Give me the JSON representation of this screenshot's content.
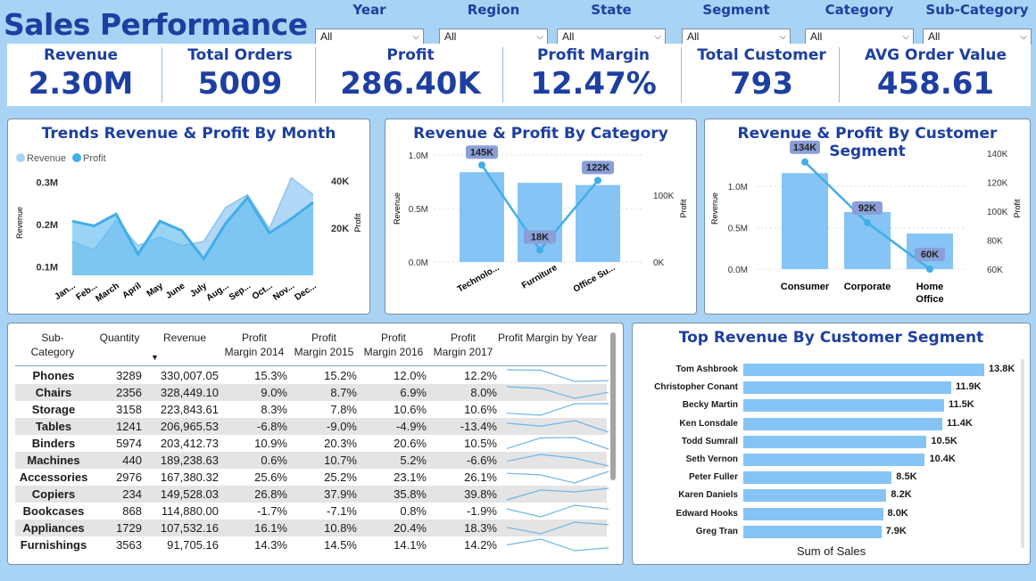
{
  "header": {
    "title": "Sales Performance"
  },
  "slicers": [
    {
      "label": "Year",
      "value": "All"
    },
    {
      "label": "Region",
      "value": "All"
    },
    {
      "label": "State",
      "value": "All"
    },
    {
      "label": "Segment",
      "value": "All"
    },
    {
      "label": "Category",
      "value": "All"
    },
    {
      "label": "Sub-Category",
      "value": "All"
    }
  ],
  "kpis": [
    {
      "label": "Revenue",
      "value": "2.30M"
    },
    {
      "label": "Total Orders",
      "value": "5009"
    },
    {
      "label": "Profit",
      "value": "286.40K"
    },
    {
      "label": "Profit Margin",
      "value": "12.47%"
    },
    {
      "label": "Total Customer",
      "value": "793"
    },
    {
      "label": "AVG Order Value",
      "value": "458.61"
    }
  ],
  "colors": {
    "accent": "#1d3fa1",
    "revenue": "#a9d3f5",
    "profit": "#41aee8",
    "bar": "#85c4f4",
    "badge": "#8a9fd8"
  },
  "monthly": {
    "title": "Trends Revenue & Profit By Month",
    "legend": {
      "revenue": "Revenue",
      "profit": "Profit"
    },
    "ylabel_left": "Revenue",
    "ylabel_right": "Profit",
    "yticks_left": [
      "0.3M",
      "0.2M",
      "0.1M"
    ],
    "yticks_right": [
      "40K",
      "20K"
    ],
    "months": [
      "Jan...",
      "Feb...",
      "March",
      "April",
      "May",
      "June",
      "July",
      "Aug...",
      "Sep...",
      "Oct...",
      "Nov...",
      "Dec..."
    ]
  },
  "category": {
    "title": "Revenue & Profit By Category",
    "ylabel_left": "Revenue",
    "ylabel_right": "Profit",
    "yticks_left": [
      "1.0M",
      "0.5M",
      "0.0M"
    ],
    "yticks_right": [
      "100K",
      "0K"
    ],
    "items": [
      "Technolo...",
      "Furniture",
      "Office Su..."
    ],
    "profit_labels": [
      "145K",
      "18K",
      "122K"
    ]
  },
  "segment": {
    "title": "Revenue & Profit By Customer Segment",
    "ylabel_left": "Revenue",
    "ylabel_right": "Profit",
    "yticks_left": [
      "1.0M",
      "0.5M",
      "0.0M"
    ],
    "yticks_right": [
      "140K",
      "120K",
      "100K",
      "80K",
      "60K"
    ],
    "items": [
      "Consumer",
      "Corporate",
      "Home",
      "Office"
    ],
    "profit_labels": [
      "134K",
      "92K",
      "60K"
    ]
  },
  "chart_data": [
    {
      "type": "area",
      "title": "Trends Revenue & Profit By Month",
      "categories": [
        "Jan...",
        "Feb...",
        "March",
        "April",
        "May",
        "June",
        "July",
        "Aug...",
        "Sep...",
        "Oct...",
        "Nov...",
        "Dec..."
      ],
      "series": [
        {
          "name": "Revenue",
          "axis": "left",
          "values": [
            0.16,
            0.14,
            0.21,
            0.15,
            0.17,
            0.15,
            0.16,
            0.24,
            0.27,
            0.19,
            0.31,
            0.27
          ]
        },
        {
          "name": "Profit",
          "axis": "right",
          "values": [
            23,
            21,
            26,
            9,
            23,
            19,
            7,
            22,
            33,
            18,
            24,
            31
          ]
        }
      ],
      "ylim_left": [
        0.08,
        0.33
      ],
      "ylim_right": [
        0,
        45
      ]
    },
    {
      "type": "bar",
      "title": "Revenue & Profit By Category",
      "categories": [
        "Technolo...",
        "Furniture",
        "Office Su..."
      ],
      "series": [
        {
          "name": "Revenue",
          "axis": "left",
          "values": [
            0.84,
            0.74,
            0.72
          ]
        },
        {
          "name": "Profit",
          "axis": "right",
          "values": [
            145,
            18,
            122
          ]
        }
      ],
      "ylim_left": [
        0,
        1.0
      ],
      "ylim_right": [
        0,
        160
      ]
    },
    {
      "type": "bar",
      "title": "Revenue & Profit By Customer Segment",
      "categories": [
        "Consumer",
        "Corporate",
        "Home Office"
      ],
      "series": [
        {
          "name": "Revenue",
          "axis": "left",
          "values": [
            1.16,
            0.69,
            0.43
          ]
        },
        {
          "name": "Profit",
          "axis": "right",
          "values": [
            134,
            92,
            60
          ]
        }
      ],
      "ylim_left": [
        0,
        1.4
      ],
      "ylim_right": [
        60,
        140
      ]
    },
    {
      "type": "bar",
      "title": "Top Revenue By Customer Segment",
      "xlabel": "Sum of Sales",
      "categories": [
        "Tom Ashbrook",
        "Christopher Conant",
        "Becky Martin",
        "Ken Lonsdale",
        "Todd Sumrall",
        "Seth Vernon",
        "Peter Fuller",
        "Karen Daniels",
        "Edward Hooks",
        "Greg Tran"
      ],
      "values": [
        13.8,
        11.9,
        11.5,
        11.4,
        10.5,
        10.4,
        8.5,
        8.2,
        8.0,
        7.9
      ],
      "labels": [
        "13.8K",
        "11.9K",
        "11.5K",
        "11.4K",
        "10.5K",
        "10.4K",
        "8.5K",
        "8.2K",
        "8.0K",
        "7.9K"
      ]
    }
  ],
  "table": {
    "headers": [
      "Sub-\nCategory",
      "Quantity",
      "Revenue",
      "Profit\nMargin 2014",
      "Profit\nMargin 2015",
      "Profit\nMargin 2016",
      "Profit\nMargin 2017",
      "Profit Margin by Year"
    ],
    "sort_indicator": "▼",
    "rows": [
      {
        "name": "Phones",
        "qty": "3289",
        "rev": "330,007.05",
        "m14": "15.3%",
        "m15": "15.2%",
        "m16": "12.0%",
        "m17": "12.2%",
        "spark": [
          15.3,
          15.2,
          12.0,
          12.2
        ]
      },
      {
        "name": "Chairs",
        "qty": "2356",
        "rev": "328,449.10",
        "m14": "9.0%",
        "m15": "8.7%",
        "m16": "6.9%",
        "m17": "8.0%",
        "spark": [
          9.0,
          8.7,
          6.9,
          8.0
        ]
      },
      {
        "name": "Storage",
        "qty": "3158",
        "rev": "223,843.61",
        "m14": "8.3%",
        "m15": "7.8%",
        "m16": "10.6%",
        "m17": "10.6%",
        "spark": [
          8.3,
          7.8,
          10.6,
          10.6
        ]
      },
      {
        "name": "Tables",
        "qty": "1241",
        "rev": "206,965.53",
        "m14": "-6.8%",
        "m15": "-9.0%",
        "m16": "-4.9%",
        "m17": "-13.4%",
        "spark": [
          -6.8,
          -9.0,
          -4.9,
          -13.4
        ]
      },
      {
        "name": "Binders",
        "qty": "5974",
        "rev": "203,412.73",
        "m14": "10.9%",
        "m15": "20.3%",
        "m16": "20.6%",
        "m17": "10.5%",
        "spark": [
          10.9,
          20.3,
          20.6,
          10.5
        ]
      },
      {
        "name": "Machines",
        "qty": "440",
        "rev": "189,238.63",
        "m14": "0.6%",
        "m15": "10.7%",
        "m16": "5.2%",
        "m17": "-6.6%",
        "spark": [
          0.6,
          10.7,
          5.2,
          -6.6
        ]
      },
      {
        "name": "Accessories",
        "qty": "2976",
        "rev": "167,380.32",
        "m14": "25.6%",
        "m15": "25.2%",
        "m16": "23.1%",
        "m17": "26.1%",
        "spark": [
          25.6,
          25.2,
          23.1,
          26.1
        ]
      },
      {
        "name": "Copiers",
        "qty": "234",
        "rev": "149,528.03",
        "m14": "26.8%",
        "m15": "37.9%",
        "m16": "35.8%",
        "m17": "39.8%",
        "spark": [
          26.8,
          37.9,
          35.8,
          39.8
        ]
      },
      {
        "name": "Bookcases",
        "qty": "868",
        "rev": "114,880.00",
        "m14": "-1.7%",
        "m15": "-7.1%",
        "m16": "0.8%",
        "m17": "-1.9%",
        "spark": [
          -1.7,
          -7.1,
          0.8,
          -1.9
        ]
      },
      {
        "name": "Appliances",
        "qty": "1729",
        "rev": "107,532.16",
        "m14": "16.1%",
        "m15": "10.8%",
        "m16": "20.4%",
        "m17": "18.3%",
        "spark": [
          16.1,
          10.8,
          20.4,
          18.3
        ]
      },
      {
        "name": "Furnishings",
        "qty": "3563",
        "rev": "91,705.16",
        "m14": "14.3%",
        "m15": "14.5%",
        "m16": "14.1%",
        "m17": "14.2%",
        "spark": [
          14.3,
          14.5,
          14.1,
          14.2
        ]
      }
    ]
  },
  "top_customers": {
    "title": "Top Revenue By Customer Segment",
    "xlabel": "Sum of Sales"
  }
}
